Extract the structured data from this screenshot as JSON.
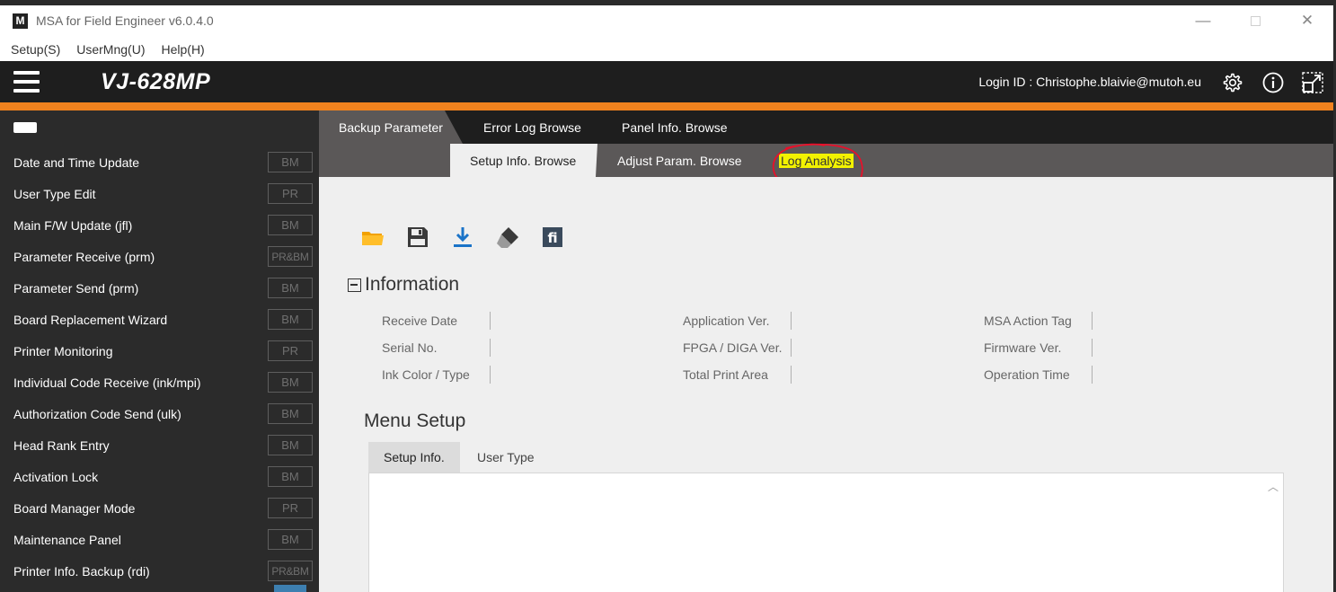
{
  "window": {
    "title": "MSA for Field Engineer v6.0.4.0",
    "logo_letter": "M",
    "minimize": "—",
    "close": "✕"
  },
  "menubar": {
    "items": [
      "Setup(S)",
      "UserMng(U)",
      "Help(H)"
    ]
  },
  "header": {
    "model": "VJ-628MP",
    "login_id": "Login ID : Christophe.blaivie@mutoh.eu",
    "icons": [
      "gear-icon",
      "info-icon",
      "expand-icon"
    ]
  },
  "sidebar": {
    "items": [
      {
        "label": "Date and Time Update",
        "badge": "BM"
      },
      {
        "label": "User Type Edit",
        "badge": "PR"
      },
      {
        "label": "Main F/W Update (jfl)",
        "badge": "BM"
      },
      {
        "label": "Parameter Receive (prm)",
        "badge": "PR&BM"
      },
      {
        "label": "Parameter Send (prm)",
        "badge": "BM"
      },
      {
        "label": "Board Replacement Wizard",
        "badge": "BM"
      },
      {
        "label": "Printer Monitoring",
        "badge": "PR"
      },
      {
        "label": "Individual Code Receive (ink/mpi)",
        "badge": "BM"
      },
      {
        "label": "Authorization Code Send (ulk)",
        "badge": "BM"
      },
      {
        "label": "Head Rank Entry",
        "badge": "BM"
      },
      {
        "label": "Activation Lock",
        "badge": "BM"
      },
      {
        "label": "Board Manager Mode",
        "badge": "PR"
      },
      {
        "label": "Maintenance Panel",
        "badge": "BM"
      },
      {
        "label": "Printer Info. Backup (rdi)",
        "badge": "PR&BM"
      }
    ]
  },
  "tabs": {
    "row1": [
      "Backup Parameter",
      "Error Log Browse",
      "Panel Info. Browse"
    ],
    "row2": [
      "Setup Info. Browse",
      "Adjust Param. Browse",
      "Log Analysis"
    ],
    "active_row1": "Backup Parameter",
    "active_row2": "Setup Info. Browse",
    "highlighted": "Log Analysis"
  },
  "toolbar": {
    "icons": [
      "open-folder-icon",
      "save-icon",
      "download-icon",
      "eraser-icon",
      "fi-icon"
    ],
    "fi_text": "fi"
  },
  "information": {
    "title": "Information",
    "labels": [
      "Receive Date",
      "Application Ver.",
      "MSA Action Tag",
      "Serial No.",
      "FPGA / DIGA Ver.",
      "Firmware Ver.",
      "Ink Color / Type",
      "Total Print Area",
      "Operation Time"
    ]
  },
  "menu_setup": {
    "title": "Menu Setup",
    "tabs": [
      "Setup Info.",
      "User Type"
    ],
    "active_tab": "Setup Info.",
    "scroll_up": "︿"
  },
  "colors": {
    "accent_orange": "#f0821e",
    "header_dark": "#1e1e1e",
    "sidebar_bg": "#2b2b2b",
    "highlight_yellow": "#f2f200",
    "annotation_red": "#e8102a"
  }
}
